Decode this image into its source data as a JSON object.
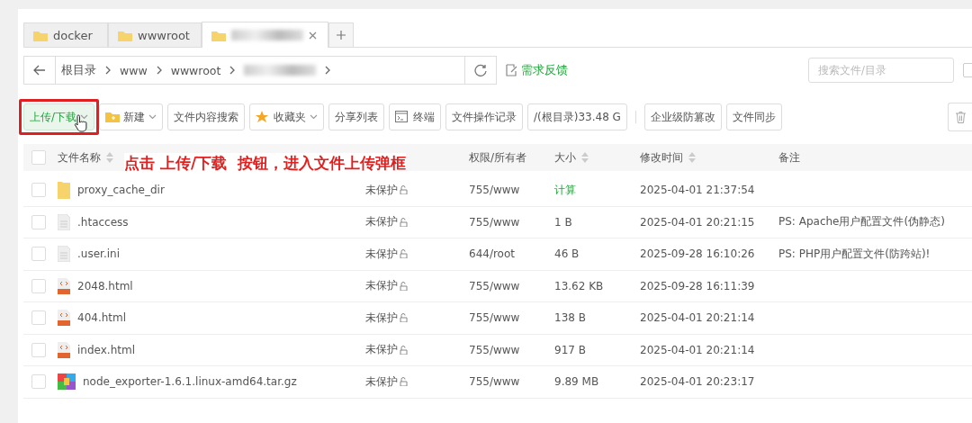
{
  "tabs": [
    {
      "label": "docker",
      "selected": false,
      "blurred": false
    },
    {
      "label": "wwwroot",
      "selected": false,
      "blurred": false
    },
    {
      "selected": true,
      "blurred": true
    }
  ],
  "path_bar": {
    "crumbs": [
      {
        "label": "根目录",
        "blurred": false
      },
      {
        "label": "www",
        "blurred": false
      },
      {
        "label": "wwwroot",
        "blurred": false
      },
      {
        "blurred": true
      }
    ],
    "feedback": "需求反馈"
  },
  "search": {
    "placeholder": "搜索文件/目录",
    "option_checked": false
  },
  "toolbar": [
    {
      "label": "上传/下载",
      "dropdown": true,
      "kind": "upload"
    },
    {
      "label": "新建",
      "dropdown": true,
      "kind": "new"
    },
    {
      "label": "文件内容搜索",
      "dropdown": false,
      "kind": "plain"
    },
    {
      "label": "收藏夹",
      "dropdown": true,
      "kind": "favorites"
    },
    {
      "label": "分享列表",
      "dropdown": false,
      "kind": "plain"
    },
    {
      "label": "终端",
      "dropdown": false,
      "kind": "terminal"
    },
    {
      "label": "文件操作记录",
      "dropdown": false,
      "kind": "plain"
    },
    {
      "label": "/(根目录)33.48 G",
      "dropdown": false,
      "kind": "plain"
    },
    {
      "kind": "separator"
    },
    {
      "label": "企业级防篡改",
      "dropdown": false,
      "kind": "plain"
    },
    {
      "label": "文件同步",
      "dropdown": false,
      "kind": "plain"
    }
  ],
  "table": {
    "all_checked": false,
    "columns": [
      {
        "label": "文件名称",
        "sortable": true
      },
      {},
      {
        "label": "权限/所有者",
        "sortable": false
      },
      {
        "label": "大小",
        "sortable": true
      },
      {
        "label": "修改时间",
        "sortable": true
      },
      {
        "label": "备注",
        "sortable": false
      }
    ],
    "rows": [
      {
        "checked": false,
        "kind": "folder",
        "name": "proxy_cache_dir",
        "protection": "未保护",
        "permission": "755/www",
        "size": "计算",
        "size_is_link": true,
        "modified": "2025-04-01 21:37:54"
      },
      {
        "checked": false,
        "kind": "text",
        "name": ".htaccess",
        "protection": "未保护",
        "permission": "755/www",
        "size": "1 B",
        "size_is_link": false,
        "modified": "2025-04-01 20:21:15",
        "note": "PS: Apache用户配置文件(伪静态)"
      },
      {
        "checked": false,
        "kind": "text",
        "name": ".user.ini",
        "protection": "未保护",
        "permission": "644/root",
        "size": "46 B",
        "size_is_link": false,
        "modified": "2025-09-28 16:10:26",
        "note": "PS: PHP用户配置文件(防跨站)!"
      },
      {
        "checked": false,
        "kind": "html",
        "name": "2048.html",
        "protection": "未保护",
        "permission": "755/www",
        "size": "13.62 KB",
        "size_is_link": false,
        "modified": "2025-09-28 16:11:39"
      },
      {
        "checked": false,
        "kind": "html",
        "name": "404.html",
        "protection": "未保护",
        "permission": "755/www",
        "size": "138 B",
        "size_is_link": false,
        "modified": "2025-04-01 20:21:14"
      },
      {
        "checked": false,
        "kind": "html",
        "name": "index.html",
        "protection": "未保护",
        "permission": "755/www",
        "size": "917 B",
        "size_is_link": false,
        "modified": "2025-04-01 20:21:14"
      },
      {
        "checked": false,
        "kind": "archive",
        "name": "node_exporter-1.6.1.linux-amd64.tar.gz",
        "protection": "未保护",
        "permission": "755/www",
        "size": "9.89 MB",
        "size_is_link": false,
        "modified": "2025-04-01 20:23:17"
      }
    ]
  },
  "annotation": {
    "text": "点击 上传/下载  按钮，进入文件上传弹框"
  }
}
